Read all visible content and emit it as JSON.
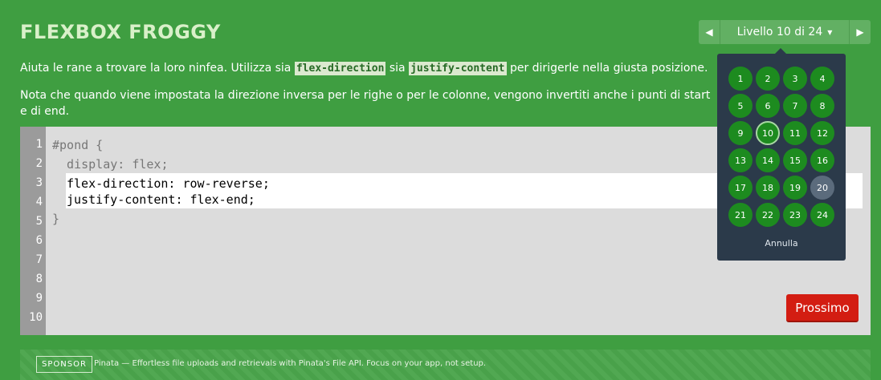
{
  "app": {
    "title": "FLEXBOX FROGGY"
  },
  "instructions": {
    "p1_before": "Aiuta le rane a trovare la loro ninfea. Utilizza sia ",
    "p1_code1": "flex-direction",
    "p1_mid": " sia ",
    "p1_code2": "justify-content",
    "p1_after": " per dirigerle nella giusta posizione.",
    "p2": "Nota che quando viene impostata la direzione inversa per le righe o per le colonne, vengono invertiti anche i punti di start e di end."
  },
  "level_nav": {
    "label": "Livello 10 di 24",
    "prev_icon": "triangle-left-icon",
    "next_icon": "triangle-right-icon"
  },
  "editor": {
    "line_numbers": [
      "1",
      "2",
      "3",
      "4",
      "5",
      "6",
      "7",
      "8",
      "9",
      "10"
    ],
    "line1": "#pond {",
    "line2": "  display: flex;",
    "input_line1": "flex-direction: row-reverse;",
    "input_line2": "justify-content: flex-end;",
    "line5": "}"
  },
  "next_button": "Prossimo",
  "level_dropdown": {
    "levels": [
      "1",
      "2",
      "3",
      "4",
      "5",
      "6",
      "7",
      "8",
      "9",
      "10",
      "11",
      "12",
      "13",
      "14",
      "15",
      "16",
      "17",
      "18",
      "19",
      "20",
      "21",
      "22",
      "23",
      "24"
    ],
    "current": "10",
    "locked": [
      "20"
    ],
    "cancel": "Annulla"
  },
  "sponsor": {
    "badge": "SPONSOR",
    "text": "Pinata — Effortless file uploads and retrievals with Pinata's File API. Focus on your app, not setup."
  },
  "colors": {
    "background": "#3f9e41",
    "editor": "#dcdcdc",
    "next_button": "#d31d12",
    "dropdown": "#2b3a4a",
    "level_circle": "#1d8b1f"
  }
}
